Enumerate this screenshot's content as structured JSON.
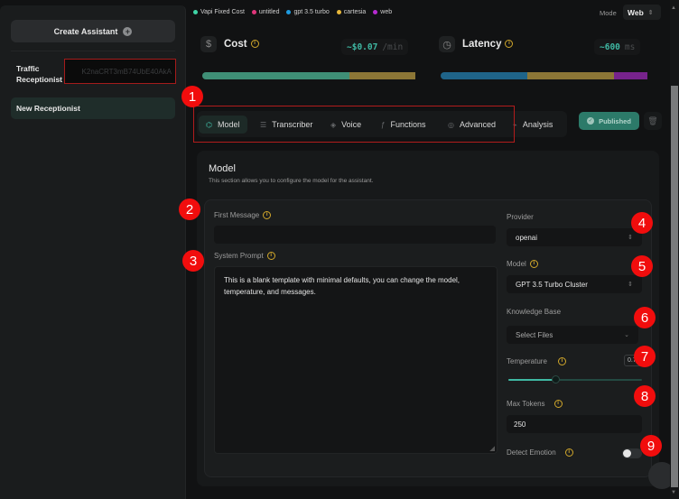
{
  "sidebar": {
    "create_label": "Create Assistant",
    "assistants": [
      {
        "name": "Traffic Receptionist",
        "id_value": "K2naCRT3mB74UbE40AkA"
      },
      {
        "name": "New Receptionist"
      }
    ]
  },
  "legend": [
    {
      "label": "Vapi Fixed Cost",
      "color": "#3fd4a6"
    },
    {
      "label": "untitled",
      "color": "#e0357a"
    },
    {
      "label": "gpt 3.5 turbo",
      "color": "#1e9be0"
    },
    {
      "label": "cartesia",
      "color": "#e8b73a"
    },
    {
      "label": "web",
      "color": "#b62ad0"
    }
  ],
  "mode": {
    "label": "Mode",
    "value": "Web"
  },
  "metrics": {
    "cost": {
      "title": "Cost",
      "value": "~$0.07",
      "unit": "/min",
      "segments": [
        {
          "name": "Vapi Fixed Cost",
          "fraction": 0.69,
          "color": "#3f8f76"
        },
        {
          "name": "cartesia",
          "fraction": 0.31,
          "color": "#8c7636"
        }
      ]
    },
    "latency": {
      "title": "Latency",
      "value": "~600",
      "unit": "ms",
      "segments": [
        {
          "name": "gpt 3.5 turbo",
          "fraction": 0.42,
          "color": "#1f6489"
        },
        {
          "name": "cartesia",
          "fraction": 0.42,
          "color": "#8c7636"
        },
        {
          "name": "web",
          "fraction": 0.16,
          "color": "#77238c"
        }
      ]
    }
  },
  "tabs": [
    {
      "label": "Model",
      "icon": "model-icon",
      "glyph": "⌬",
      "active": true
    },
    {
      "label": "Transcriber",
      "icon": "transcriber-icon",
      "glyph": "☰",
      "active": false
    },
    {
      "label": "Voice",
      "icon": "voice-icon",
      "glyph": "◈",
      "active": false
    },
    {
      "label": "Functions",
      "icon": "functions-icon",
      "glyph": "ƒ",
      "active": false
    },
    {
      "label": "Advanced",
      "icon": "advanced-icon",
      "glyph": "◎",
      "active": false
    },
    {
      "label": "Analysis",
      "icon": "analysis-icon",
      "glyph": "⌁",
      "active": false
    }
  ],
  "actions": {
    "publish_label": "Published"
  },
  "model_section": {
    "title": "Model",
    "description": "This section allows you to configure the model for the assistant.",
    "first_message": {
      "label": "First Message",
      "value": ""
    },
    "system_prompt": {
      "label": "System Prompt",
      "value": "This is a blank template with minimal defaults, you can change the model, temperature, and messages."
    },
    "provider": {
      "label": "Provider",
      "value": "openai"
    },
    "model": {
      "label": "Model",
      "value": "GPT 3.5 Turbo Cluster"
    },
    "knowledge_base": {
      "label": "Knowledge Base",
      "placeholder": "Select Files"
    },
    "temperature": {
      "label": "Temperature",
      "value_text": "0.7",
      "fraction": 0.35
    },
    "max_tokens": {
      "label": "Max Tokens",
      "value": "250"
    },
    "detect_emotion": {
      "label": "Detect Emotion",
      "enabled": false
    }
  },
  "annotations": [
    "1",
    "2",
    "3",
    "4",
    "5",
    "6",
    "7",
    "8",
    "9"
  ]
}
